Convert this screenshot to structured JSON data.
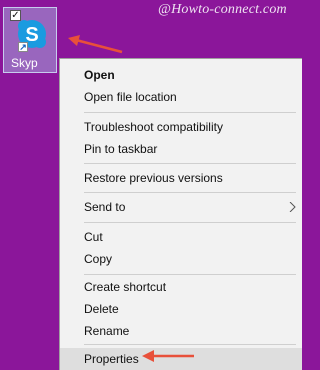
{
  "watermark": "@Howto-connect.com",
  "desktop_icon": {
    "label": "Skyp",
    "checkbox": "✓",
    "shortcut_badge": "↗",
    "icon": "skype-icon"
  },
  "menu": {
    "items": [
      {
        "label": "Open"
      },
      {
        "label": "Open file location"
      },
      {
        "label": "Troubleshoot compatibility"
      },
      {
        "label": "Pin to taskbar"
      },
      {
        "label": "Restore previous versions"
      },
      {
        "label": "Send to"
      },
      {
        "label": "Cut"
      },
      {
        "label": "Copy"
      },
      {
        "label": "Create shortcut"
      },
      {
        "label": "Delete"
      },
      {
        "label": "Rename"
      },
      {
        "label": "Properties"
      }
    ]
  },
  "colors": {
    "desktop": "#8b169a",
    "menu_bg": "#f2f2f2",
    "annotation_arrow": "#e8503a",
    "skype_blue": "#1a9be0"
  }
}
